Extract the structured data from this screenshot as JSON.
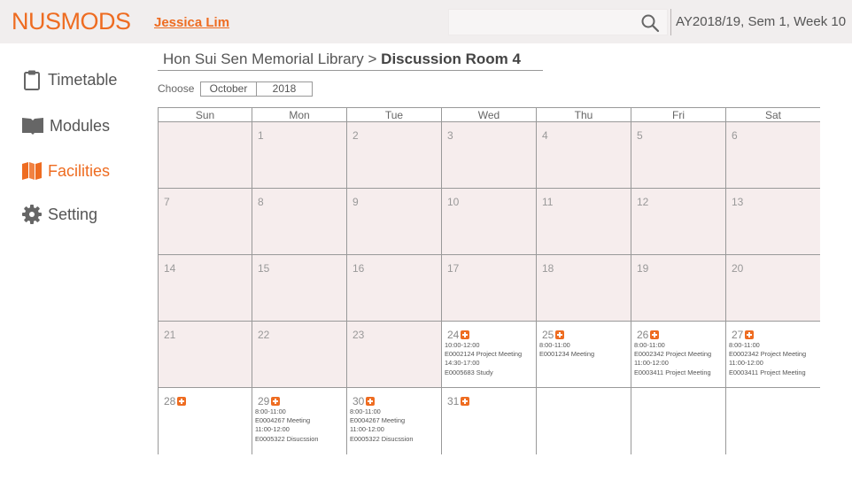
{
  "header": {
    "logo": "NUSMODS",
    "user": "Jessica Lim",
    "search_placeholder": "",
    "semester": "AY2018/19, Sem 1, Week 10"
  },
  "colors": {
    "accent": "#ee6c21",
    "header_bg": "#f1eeee",
    "unavailable_day": "#f6eded"
  },
  "sidebar": {
    "items": [
      {
        "label": "Timetable",
        "icon": "clipboard-icon",
        "active": false
      },
      {
        "label": "Modules",
        "icon": "book-icon",
        "active": false
      },
      {
        "label": "Facilities",
        "icon": "map-icon",
        "active": true
      },
      {
        "label": "Setting",
        "icon": "gear-icon",
        "active": false
      }
    ]
  },
  "breadcrumb": {
    "location": "Hon Sui Sen Memorial Library",
    "separator": ">",
    "room": "Discussion Room 4"
  },
  "chooser": {
    "label": "Choose",
    "month": "October",
    "year": "2018"
  },
  "calendar": {
    "weekdays": [
      "Sun",
      "Mon",
      "Tue",
      "Wed",
      "Thu",
      "Fri",
      "Sat"
    ],
    "weeks": [
      [
        {
          "day": ""
        },
        {
          "day": "1"
        },
        {
          "day": "2"
        },
        {
          "day": "3"
        },
        {
          "day": "4"
        },
        {
          "day": "5"
        },
        {
          "day": "6"
        }
      ],
      [
        {
          "day": "7"
        },
        {
          "day": "8"
        },
        {
          "day": "9"
        },
        {
          "day": "10"
        },
        {
          "day": "11"
        },
        {
          "day": "12"
        },
        {
          "day": "13"
        }
      ],
      [
        {
          "day": "14"
        },
        {
          "day": "15"
        },
        {
          "day": "16"
        },
        {
          "day": "17"
        },
        {
          "day": "18"
        },
        {
          "day": "19"
        },
        {
          "day": "20"
        }
      ],
      [
        {
          "day": "21"
        },
        {
          "day": "22"
        },
        {
          "day": "23"
        },
        {
          "day": "24",
          "bookable": true,
          "events": [
            "10:00-12:00",
            "E0002124 Project Meeting",
            "14:30-17:00",
            "E0005683 Study"
          ]
        },
        {
          "day": "25",
          "bookable": true,
          "events": [
            "8:00-11:00",
            "E0001234 Meeting"
          ]
        },
        {
          "day": "26",
          "bookable": true,
          "events": [
            "8:00-11:00",
            "E0002342 Project Meeting",
            "11:00-12:00",
            "E0003411 Project Meeting"
          ]
        },
        {
          "day": "27",
          "bookable": true,
          "events": [
            "8:00-11:00",
            "E0002342 Project Meeting",
            "11:00-12:00",
            "E0003411 Project Meeting"
          ]
        }
      ],
      [
        {
          "day": "28",
          "bookable": true,
          "events": []
        },
        {
          "day": "29",
          "bookable": true,
          "events": [
            "8:00-11:00",
            "E0004267 Meeting",
            "11:00-12:00",
            "E0005322 Disucssion"
          ]
        },
        {
          "day": "30",
          "bookable": true,
          "events": [
            "8:00-11:00",
            "E0004267 Meeting",
            "11:00-12:00",
            "E0005322 Disucssion"
          ]
        },
        {
          "day": "31",
          "bookable": true,
          "events": []
        },
        {
          "day": "",
          "bookable": true,
          "blank": true
        },
        {
          "day": "",
          "bookable": true,
          "blank": true
        },
        {
          "day": "",
          "bookable": true,
          "blank": true
        }
      ]
    ]
  }
}
